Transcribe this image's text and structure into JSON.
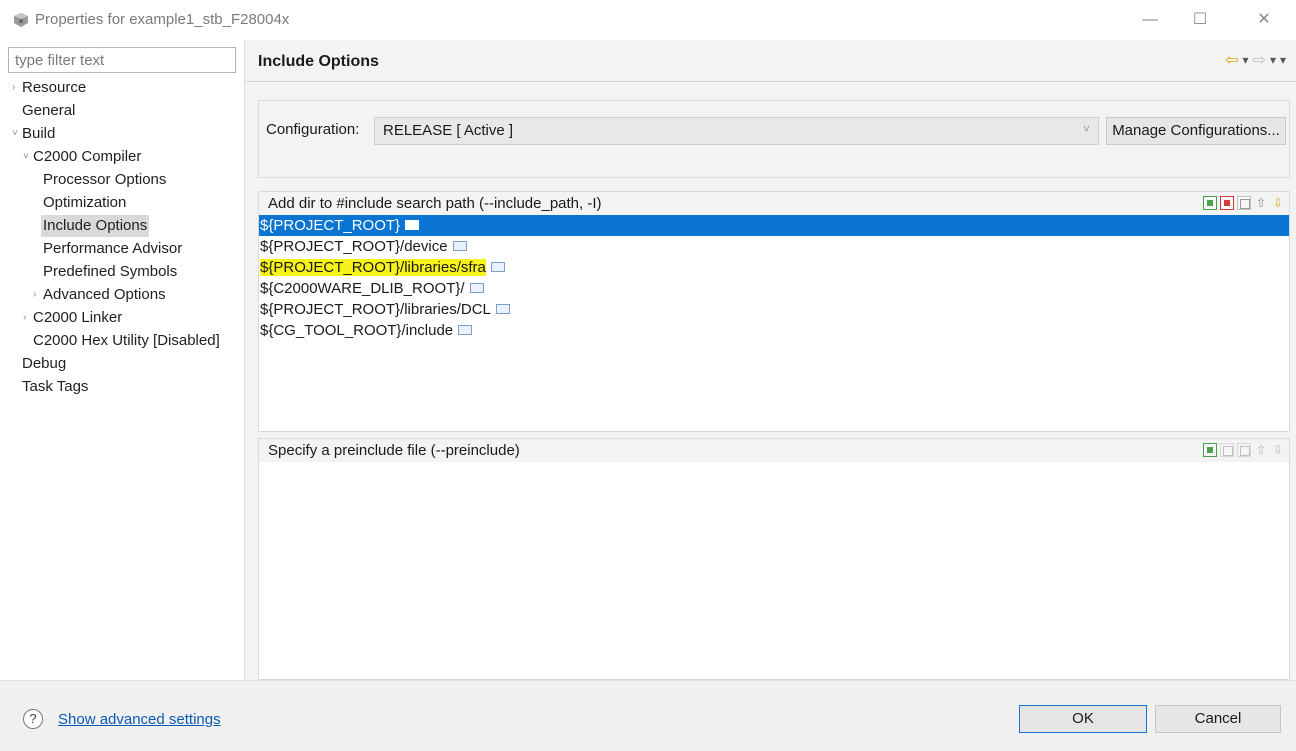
{
  "window": {
    "title": "Properties for example1_stb_F28004x",
    "minimize_glyph": "—",
    "maximize_glyph": "☐",
    "close_glyph": "✕"
  },
  "sidebar": {
    "filter_placeholder": "type filter text",
    "items": [
      {
        "label": "Resource",
        "arrow": "›"
      },
      {
        "label": "General",
        "arrow": ""
      },
      {
        "label": "Build",
        "arrow": "˅"
      },
      {
        "label": "C2000 Compiler",
        "arrow": "˅"
      },
      {
        "label": "Processor Options",
        "arrow": ""
      },
      {
        "label": "Optimization",
        "arrow": ""
      },
      {
        "label": "Include Options",
        "arrow": "",
        "selected": true
      },
      {
        "label": "Performance Advisor",
        "arrow": ""
      },
      {
        "label": "Predefined Symbols",
        "arrow": ""
      },
      {
        "label": "Advanced Options",
        "arrow": "›"
      },
      {
        "label": "C2000 Linker",
        "arrow": "›"
      },
      {
        "label": "C2000 Hex Utility  [Disabled]",
        "arrow": ""
      },
      {
        "label": "Debug",
        "arrow": ""
      },
      {
        "label": "Task Tags",
        "arrow": ""
      }
    ]
  },
  "page": {
    "title": "Include Options",
    "nav_icons": [
      "back-arrow-icon",
      "dropdown-icon",
      "forward-arrow-icon",
      "dropdown-icon",
      "view-menu-icon"
    ]
  },
  "configuration": {
    "label": "Configuration:",
    "value": "RELEASE  [ Active ]",
    "chevron": "˅",
    "manage_button": "Manage Configurations..."
  },
  "include_paths": {
    "header": "Add dir to #include search path (--include_path, -I)",
    "rows": [
      {
        "text": "${PROJECT_ROOT}",
        "selected": true,
        "highlighted": false
      },
      {
        "text": "${PROJECT_ROOT}/device",
        "selected": false,
        "highlighted": false
      },
      {
        "text": "${PROJECT_ROOT}/libraries/sfra",
        "selected": false,
        "highlighted": true
      },
      {
        "text": "${C2000WARE_DLIB_ROOT}/",
        "selected": false,
        "highlighted": false
      },
      {
        "text": "${PROJECT_ROOT}/libraries/DCL",
        "selected": false,
        "highlighted": false
      },
      {
        "text": "${CG_TOOL_ROOT}/include",
        "selected": false,
        "highlighted": false
      }
    ]
  },
  "preinclude": {
    "header": "Specify a preinclude file (--preinclude)"
  },
  "footer": {
    "help_glyph": "?",
    "advanced_link": "Show advanced settings",
    "ok_button": "OK",
    "cancel_button": "Cancel"
  },
  "colors": {
    "selection": "#0a74d2",
    "highlight": "#f7f21a",
    "link": "#0b5bb5"
  }
}
